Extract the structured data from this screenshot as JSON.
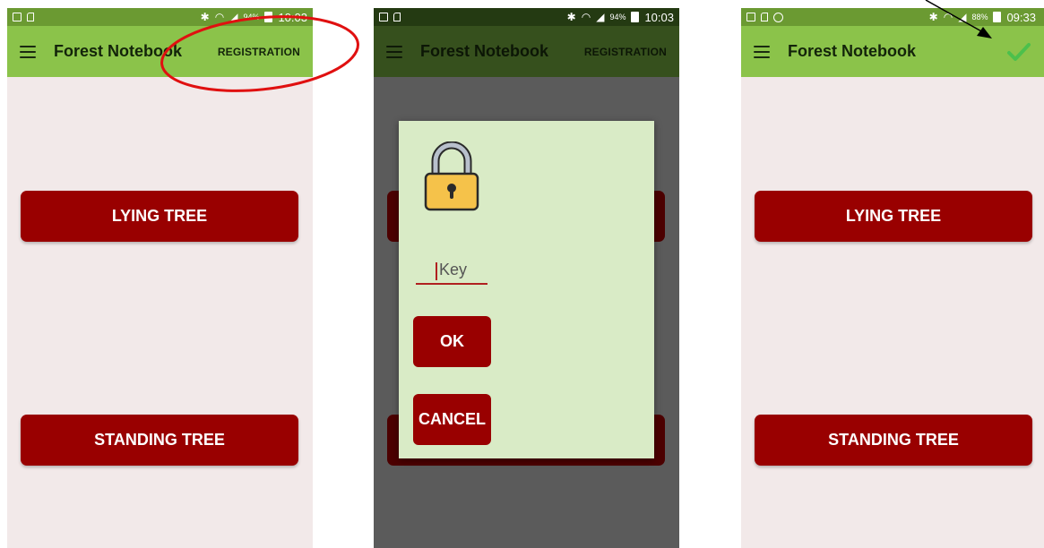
{
  "status_bar_left": {
    "battery_pct": "94%",
    "time": "10:03"
  },
  "status_bar_middle": {
    "battery_pct": "94%",
    "time": "10:03"
  },
  "status_bar_right": {
    "battery_pct": "88%",
    "time": "09:33"
  },
  "app": {
    "title": "Forest Notebook",
    "registration_label": "REGISTRATION",
    "lying_tree_label": "LYING TREE",
    "standing_tree_label": "STANDING TREE"
  },
  "dialog": {
    "key_placeholder": "Key",
    "ok_label": "OK",
    "cancel_label": "CANCEL"
  },
  "colors": {
    "appbar": "#8bc34a",
    "statusbar": "#6b9a32",
    "button": "#990000",
    "dialog_bg": "#d9ebc6",
    "annotation": "#e01010"
  },
  "icons": {
    "menu": "menu-icon",
    "lock": "lock-icon",
    "check": "checkmark-icon"
  }
}
